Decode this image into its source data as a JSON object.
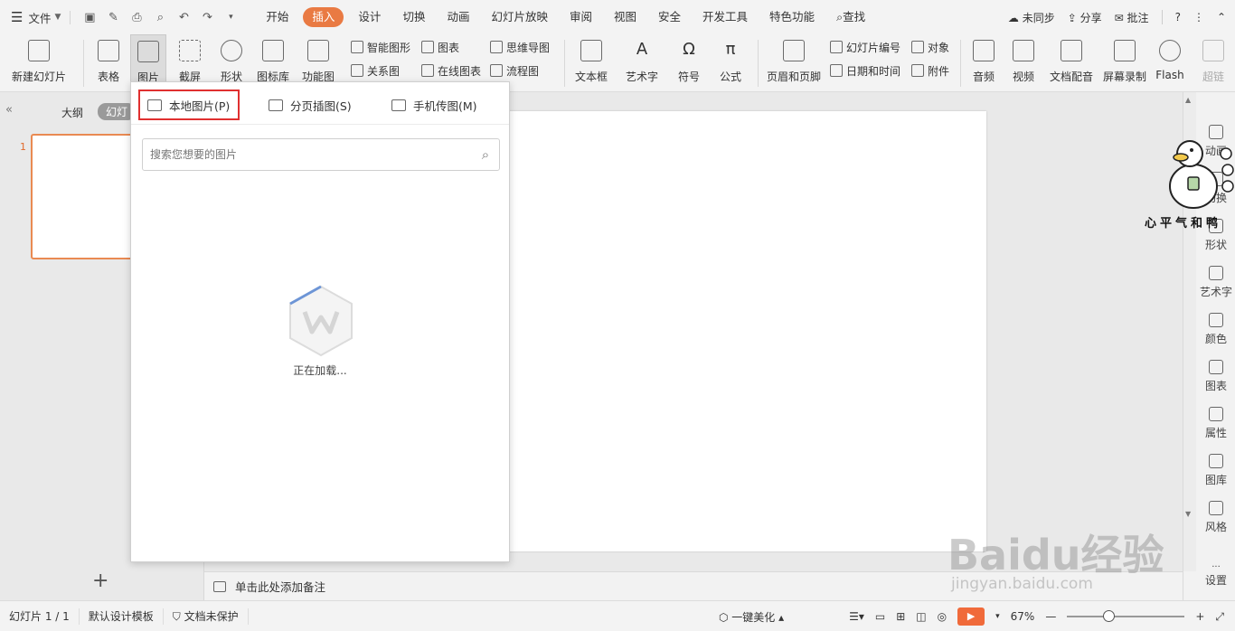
{
  "menubar": {
    "file_label": "文件",
    "tabs": [
      "开始",
      "插入",
      "设计",
      "切换",
      "动画",
      "幻灯片放映",
      "审阅",
      "视图",
      "安全",
      "开发工具",
      "特色功能"
    ],
    "active_tab": "插入",
    "search_label": "查找",
    "sync_label": "未同步",
    "share_label": "分享",
    "comment_label": "批注"
  },
  "ribbon": {
    "new_slide": "新建幻灯片",
    "table": "表格",
    "picture": "图片",
    "screenshot": "截屏",
    "shape": "形状",
    "icon_lib": "图标库",
    "func_chart": "功能图",
    "smart_shape": "智能图形",
    "relation": "关系图",
    "chart": "图表",
    "online_chart": "在线图表",
    "mindmap": "思维导图",
    "flowchart": "流程图",
    "textbox": "文本框",
    "wordart": "艺术字",
    "symbol": "符号",
    "formula": "公式",
    "header_footer": "页眉和页脚",
    "slide_number": "幻灯片编号",
    "datetime": "日期和时间",
    "object": "对象",
    "attachment": "附件",
    "audio": "音频",
    "video": "视频",
    "doc_voice": "文档配音",
    "screen_rec": "屏幕录制",
    "flash": "Flash",
    "hyperlink": "超链"
  },
  "leftpanel": {
    "outline_tab": "大纲",
    "slides_tab": "幻灯",
    "slide_number": "1",
    "add_label": "+"
  },
  "dropdown": {
    "local_picture": "本地图片(P)",
    "page_insert": "分页插图(S)",
    "phone_picture": "手机传图(M)",
    "search_placeholder": "搜索您想要的图片",
    "loading": "正在加载..."
  },
  "notes": {
    "placeholder": "单击此处添加备注"
  },
  "rightbar": {
    "items": [
      "动画",
      "切换",
      "形状",
      "艺术字",
      "颜色",
      "图表",
      "属性",
      "图库",
      "风格",
      "设置"
    ]
  },
  "statusbar": {
    "slide_info": "幻灯片 1 / 1",
    "template": "默认设计模板",
    "protect": "文档未保护",
    "beautify": "一键美化",
    "zoom": "67%"
  },
  "sticker": {
    "text": "心平气和鸭"
  },
  "watermark": {
    "brand": "Baidu经验",
    "url": "jingyan.baidu.com"
  },
  "colors": {
    "accent": "#e97a43",
    "highlight_border": "#e03030",
    "play": "#f06a3a"
  }
}
